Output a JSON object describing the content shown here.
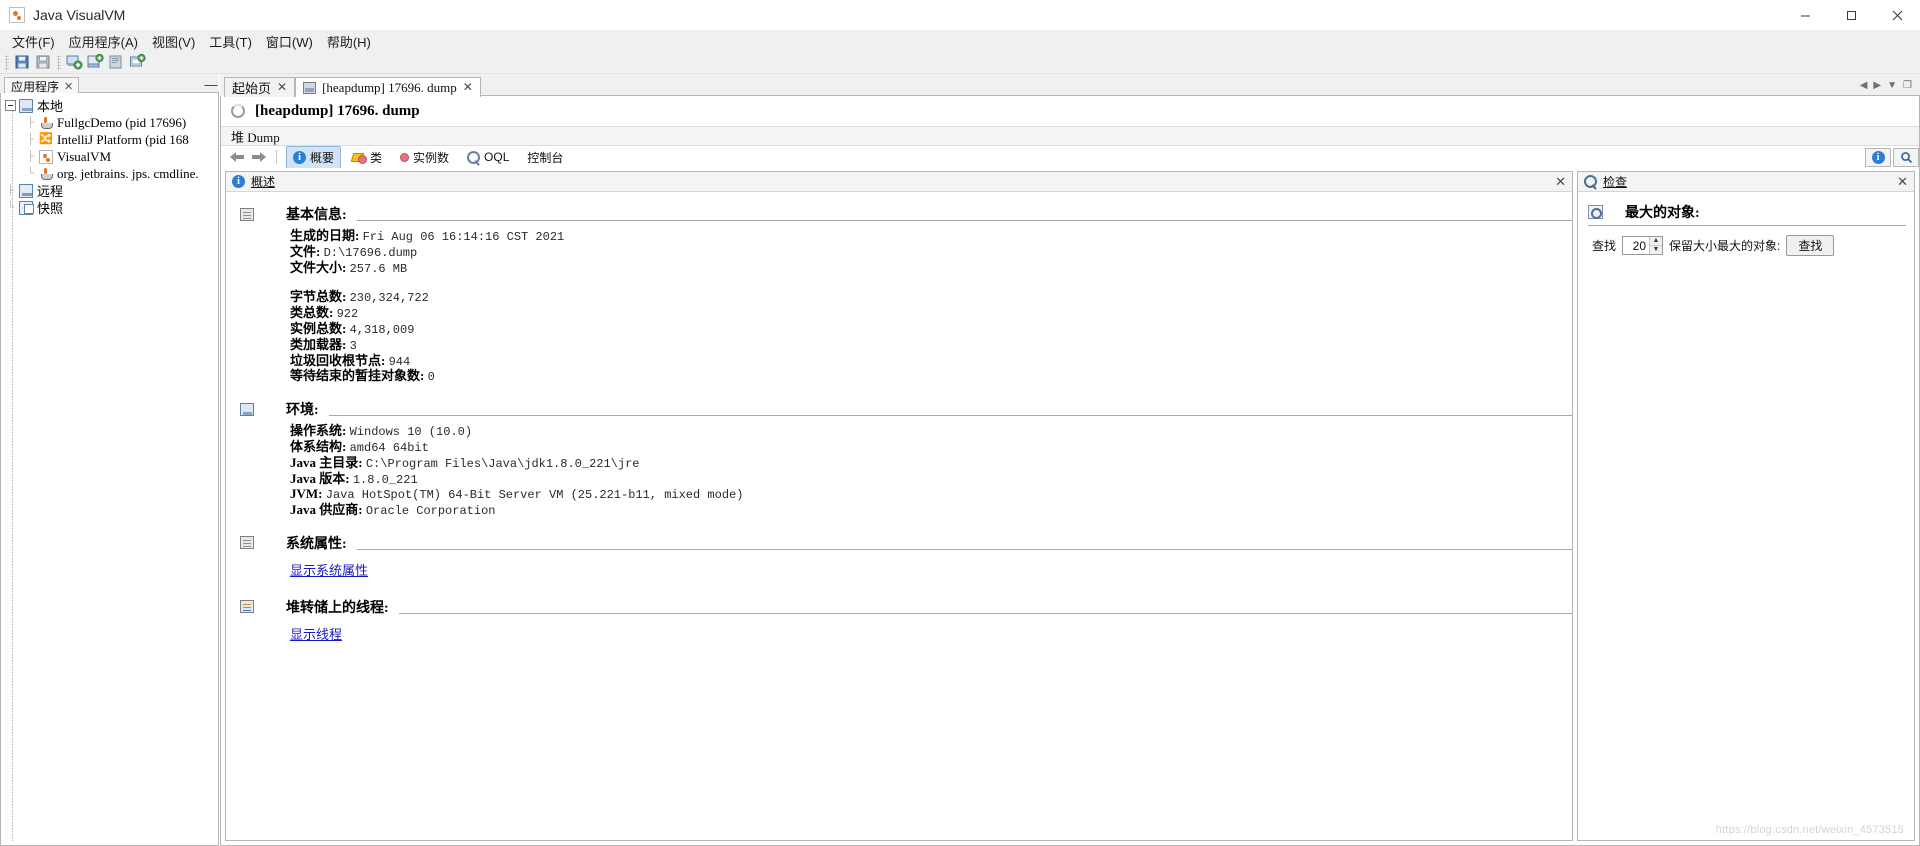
{
  "window": {
    "title": "Java VisualVM",
    "icon": "visualvm-icon",
    "minimize": "–",
    "maximize": "▢",
    "close": "✕"
  },
  "menu": {
    "items": [
      {
        "label": "文件(F)",
        "name": "menu-file"
      },
      {
        "label": "应用程序(A)",
        "name": "menu-applications"
      },
      {
        "label": "视图(V)",
        "name": "menu-view"
      },
      {
        "label": "工具(T)",
        "name": "menu-tools"
      },
      {
        "label": "窗口(W)",
        "name": "menu-window"
      },
      {
        "label": "帮助(H)",
        "name": "menu-help"
      }
    ]
  },
  "toolbar": {
    "buttons": [
      {
        "name": "open-file-button",
        "icon": "floppy-open-icon"
      },
      {
        "name": "save-button",
        "icon": "floppy-save-icon"
      },
      {
        "name": "add-jmx-connection-button",
        "icon": "jmx-add-icon"
      },
      {
        "name": "add-remote-host-button",
        "icon": "host-add-icon"
      },
      {
        "name": "snapshot-button",
        "icon": "snapshot-icon"
      },
      {
        "name": "add-application-button",
        "icon": "app-add-icon"
      }
    ]
  },
  "sidebar": {
    "tab_label": "应用程序",
    "tab_close": "✕",
    "minimize": "—",
    "tree": [
      {
        "label": "本地",
        "icon": "monitor-icon",
        "level": 0,
        "expanded": true,
        "name": "tree-node-local"
      },
      {
        "label": "FullgcDemo (pid 17696)",
        "icon": "java-icon",
        "level": 1,
        "name": "tree-node-fullgcdemo"
      },
      {
        "label": "IntelliJ Platform (pid 168",
        "icon": "intellij-icon",
        "level": 1,
        "name": "tree-node-intellij-platform"
      },
      {
        "label": "VisualVM",
        "icon": "visualvm-icon",
        "level": 1,
        "name": "tree-node-visualvm"
      },
      {
        "label": "org. jetbrains. jps. cmdline.",
        "icon": "java-icon",
        "level": 1,
        "name": "tree-node-jps-cmdline"
      },
      {
        "label": "远程",
        "icon": "remote-icon",
        "level": 0,
        "name": "tree-node-remote"
      },
      {
        "label": "快照",
        "icon": "snapshot-icon",
        "level": 0,
        "name": "tree-node-snapshots"
      }
    ]
  },
  "doc_tabs": [
    {
      "label": "起始页",
      "close": "✕",
      "active": false,
      "icon": null,
      "name": "tab-start-page"
    },
    {
      "label": "[heapdump] 17696. dump",
      "close": "✕",
      "active": true,
      "icon": "heapdump-icon",
      "name": "tab-heapdump"
    }
  ],
  "document": {
    "title": "[heapdump] 17696. dump",
    "subbar": "堆 Dump",
    "view_tabs": [
      {
        "label": "概要",
        "icon": "info-icon",
        "selected": true,
        "name": "view-tab-summary"
      },
      {
        "label": "类",
        "icon": "classes-icon",
        "selected": false,
        "name": "view-tab-classes"
      },
      {
        "label": "实例数",
        "icon": "instances-icon",
        "selected": false,
        "name": "view-tab-instances"
      },
      {
        "label": "OQL",
        "icon": "oql-icon",
        "selected": false,
        "name": "view-tab-oql"
      },
      {
        "label": "控制台",
        "icon": null,
        "selected": false,
        "name": "view-tab-console"
      }
    ]
  },
  "overview": {
    "pane_title": "概述",
    "pane_icon": "info-icon",
    "pane_close": "✕",
    "sections": [
      {
        "title": "基本信息:",
        "icon": "film-icon",
        "name": "section-basic-info",
        "rows": [
          {
            "key": "生成的日期:",
            "value": "Fri Aug 06 16:14:16 CST 2021"
          },
          {
            "key": "文件:",
            "value": "D:\\17696.dump"
          },
          {
            "key": "文件大小:",
            "value": "257.6 MB"
          },
          {
            "key": "",
            "value": ""
          },
          {
            "key": "字节总数:",
            "value": "230,324,722"
          },
          {
            "key": "类总数:",
            "value": "922"
          },
          {
            "key": "实例总数:",
            "value": "4,318,009"
          },
          {
            "key": "类加载器:",
            "value": "3"
          },
          {
            "key": "垃圾回收根节点:",
            "value": "944"
          },
          {
            "key": "等待结束的暂挂对象数:",
            "value": "0"
          }
        ]
      },
      {
        "title": "环境:",
        "icon": "monitor-icon",
        "name": "section-environment",
        "rows": [
          {
            "key": "操作系统:",
            "value": "Windows 10 (10.0)"
          },
          {
            "key": "体系结构:",
            "value": "amd64 64bit"
          },
          {
            "key": "Java 主目录:",
            "value": "C:\\Program Files\\Java\\jdk1.8.0_221\\jre"
          },
          {
            "key": "Java 版本:",
            "value": "1.8.0_221"
          },
          {
            "key": "JVM:",
            "value": "Java HotSpot(TM) 64-Bit Server VM (25.221-b11, mixed mode)"
          },
          {
            "key": "Java 供应商:",
            "value": "Oracle Corporation"
          }
        ]
      },
      {
        "title": "系统属性:",
        "icon": "properties-icon",
        "name": "section-system-properties",
        "rows": [],
        "link": "显示系统属性",
        "link_name": "show-system-properties-link"
      },
      {
        "title": "堆转储上的线程:",
        "icon": "threads-icon",
        "name": "section-threads",
        "rows": [],
        "link": "显示线程",
        "link_name": "show-threads-link"
      }
    ]
  },
  "inspect": {
    "pane_title": "检查",
    "pane_icon": "magnifier-icon",
    "pane_close": "✕",
    "section_title": "最大的对象:",
    "section_icon": "magnifier-doc-icon",
    "find_label": "查找",
    "count_value": "20",
    "retained_label": "保留大小最大的对象:",
    "find_button": "查找"
  },
  "topright": {
    "info_button": "info-icon",
    "search_button": "search-icon"
  },
  "watermark": "https://blog.csdn.net/weixin_4573515"
}
